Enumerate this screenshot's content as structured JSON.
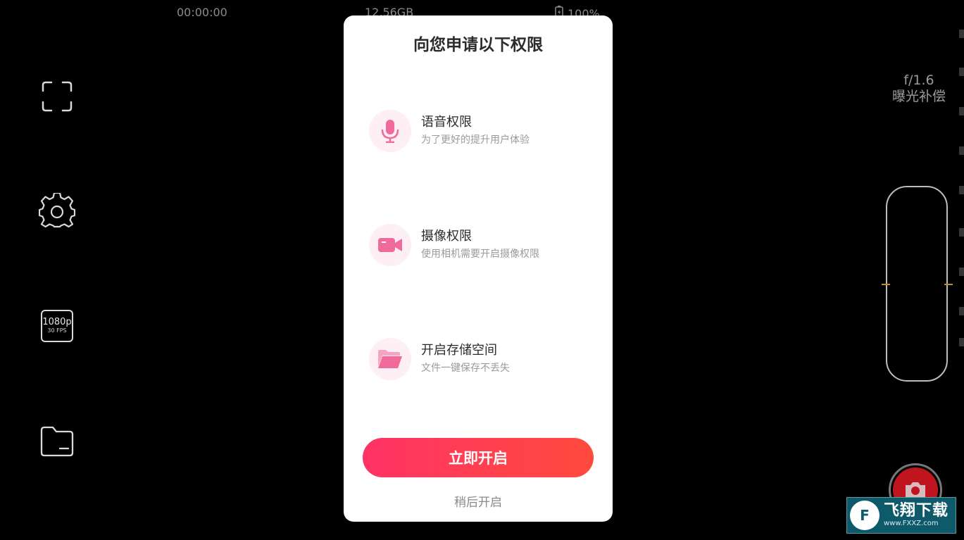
{
  "status": {
    "time": "00:00:00",
    "storage": "12.56GB",
    "battery": "100%"
  },
  "left_toolbar": {
    "resolution": "1080p",
    "fps": "30 FPS"
  },
  "right_panel": {
    "aperture": "f/1.6",
    "exposure_label": "曝光补偿"
  },
  "dialog": {
    "title": "向您申请以下权限",
    "permissions": [
      {
        "icon": "microphone-icon",
        "title": "语音权限",
        "desc": "为了更好的提升用户体验"
      },
      {
        "icon": "video-camera-icon",
        "title": "摄像权限",
        "desc": "使用相机需要开启摄像权限"
      },
      {
        "icon": "folder-icon",
        "title": "开启存储空间",
        "desc": "文件一键保存不丢失"
      }
    ],
    "primary_button": "立即开启",
    "secondary_button": "稍后开启"
  },
  "watermark": {
    "name": "飞翔下载",
    "url": "www.FXXZ.com"
  },
  "colors": {
    "accent_start": "#ff3366",
    "accent_end": "#ff4a3d",
    "icon_pink": "#f06a9c",
    "icon_bg": "#fdeff3"
  }
}
